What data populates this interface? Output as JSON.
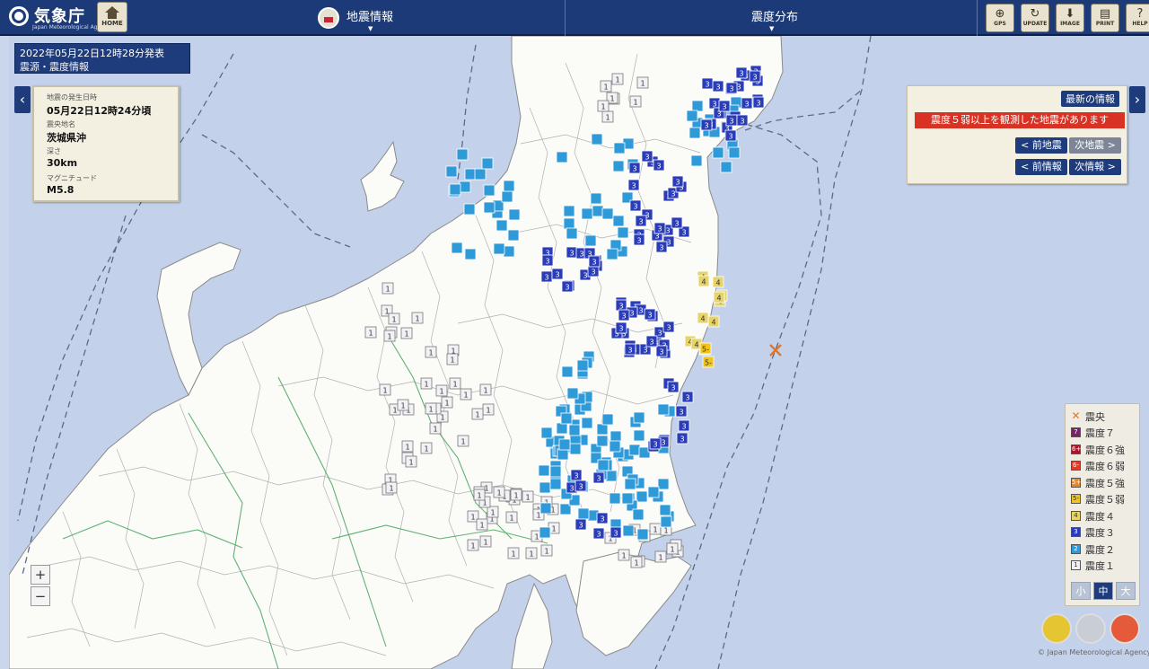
{
  "header": {
    "logo_text": "気象庁",
    "logo_sub": "Japan Meteorological Agency",
    "home_label": "HOME",
    "tab_info": "地震情報",
    "tab_dist": "震度分布",
    "tools": [
      {
        "label": "GPS",
        "icon": "target-icon"
      },
      {
        "label": "UPDATE",
        "icon": "refresh-icon"
      },
      {
        "label": "IMAGE",
        "icon": "download-icon"
      },
      {
        "label": "PRINT",
        "icon": "print-icon"
      },
      {
        "label": "HELP",
        "icon": "help-icon"
      }
    ]
  },
  "issue": {
    "line1": "2022年05月22日12時28分発表",
    "line2": "震源・震度情報"
  },
  "quake": {
    "time_caption": "地震の発生日時",
    "time": "05月22日12時24分頃",
    "place_caption": "震央地名",
    "place": "茨城県沖",
    "depth_caption": "深さ",
    "depth": "30km",
    "mag_caption": "マグニチュード",
    "magnitude": "M5.8"
  },
  "latest": {
    "title": "最新の情報",
    "alert": "震度５弱以上を観測した地震があります",
    "prev_quake": "< 前地震",
    "next_quake": "次地震 >",
    "prev_info": "< 前情報",
    "next_info": "次情報 >"
  },
  "legend": {
    "epicenter": "震央",
    "items": [
      {
        "label": "震度７",
        "code": "7",
        "color": "#7b1f6b"
      },
      {
        "label": "震度６強",
        "code": "6+",
        "color": "#a3192e"
      },
      {
        "label": "震度６弱",
        "code": "6-",
        "color": "#e03a2a"
      },
      {
        "label": "震度５強",
        "code": "5+",
        "color": "#e3872a"
      },
      {
        "label": "震度５弱",
        "code": "5-",
        "color": "#f0c419"
      },
      {
        "label": "震度４",
        "code": "4",
        "color": "#e6d46a"
      },
      {
        "label": "震度３",
        "code": "3",
        "color": "#2a3cb8"
      },
      {
        "label": "震度２",
        "code": "2",
        "color": "#2f9ad8"
      },
      {
        "label": "震度１",
        "code": "1",
        "color": "#f2f2f6"
      }
    ],
    "sizes": [
      "小",
      "中",
      "大"
    ],
    "selected_size": "中"
  },
  "zoom": {
    "in": "+",
    "out": "−"
  },
  "copyright": "© Japan Meteorological Agency",
  "colors": {
    "sea": "#c3d1ea",
    "land": "#fbfbf8",
    "epicenter": "#e0762a",
    "accent": "#1e3c7c",
    "alert": "#d83224"
  }
}
